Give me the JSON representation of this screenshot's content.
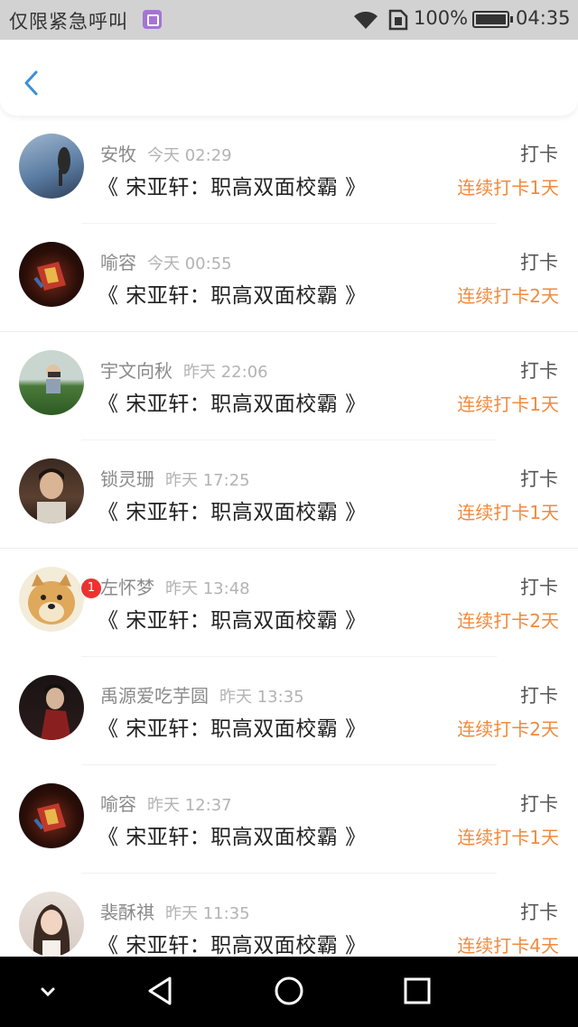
{
  "status_bar": {
    "carrier": "仅限紧急呼叫",
    "battery": "100%",
    "time": "04:35"
  },
  "nav": {
    "back_icon": "chevron-left-icon"
  },
  "colors": {
    "accent": "#f08a3e",
    "back": "#3a8fd8"
  },
  "entries": [
    {
      "name": "安牧",
      "time": "今天 02:29",
      "title": "《 宋亚轩：职高双面校霸 》",
      "tag": "打卡",
      "streak": "连续打卡1天"
    },
    {
      "name": "喻容",
      "time": "今天 00:55",
      "title": "《 宋亚轩：职高双面校霸 》",
      "tag": "打卡",
      "streak": "连续打卡2天"
    },
    {
      "name": "宇文向秋",
      "time": "昨天 22:06",
      "title": "《 宋亚轩：职高双面校霸 》",
      "tag": "打卡",
      "streak": "连续打卡1天"
    },
    {
      "name": "锁灵珊",
      "time": "昨天 17:25",
      "title": "《 宋亚轩：职高双面校霸 》",
      "tag": "打卡",
      "streak": "连续打卡1天"
    },
    {
      "name": "左怀梦",
      "time": "昨天 13:48",
      "title": "《 宋亚轩：职高双面校霸 》",
      "tag": "打卡",
      "streak": "连续打卡2天",
      "badge": "1"
    },
    {
      "name": "禹源爱吃芋圆",
      "time": "昨天 13:35",
      "title": "《 宋亚轩：职高双面校霸 》",
      "tag": "打卡",
      "streak": "连续打卡2天"
    },
    {
      "name": "喻容",
      "time": "昨天 12:37",
      "title": "《 宋亚轩：职高双面校霸 》",
      "tag": "打卡",
      "streak": "连续打卡1天"
    },
    {
      "name": "裴酥祺",
      "time": "昨天 11:35",
      "title": "《 宋亚轩：职高双面校霸 》",
      "tag": "打卡",
      "streak": "连续打卡4天"
    }
  ],
  "system_nav": [
    "collapse-icon",
    "back-triangle-icon",
    "home-circle-icon",
    "recents-square-icon"
  ]
}
